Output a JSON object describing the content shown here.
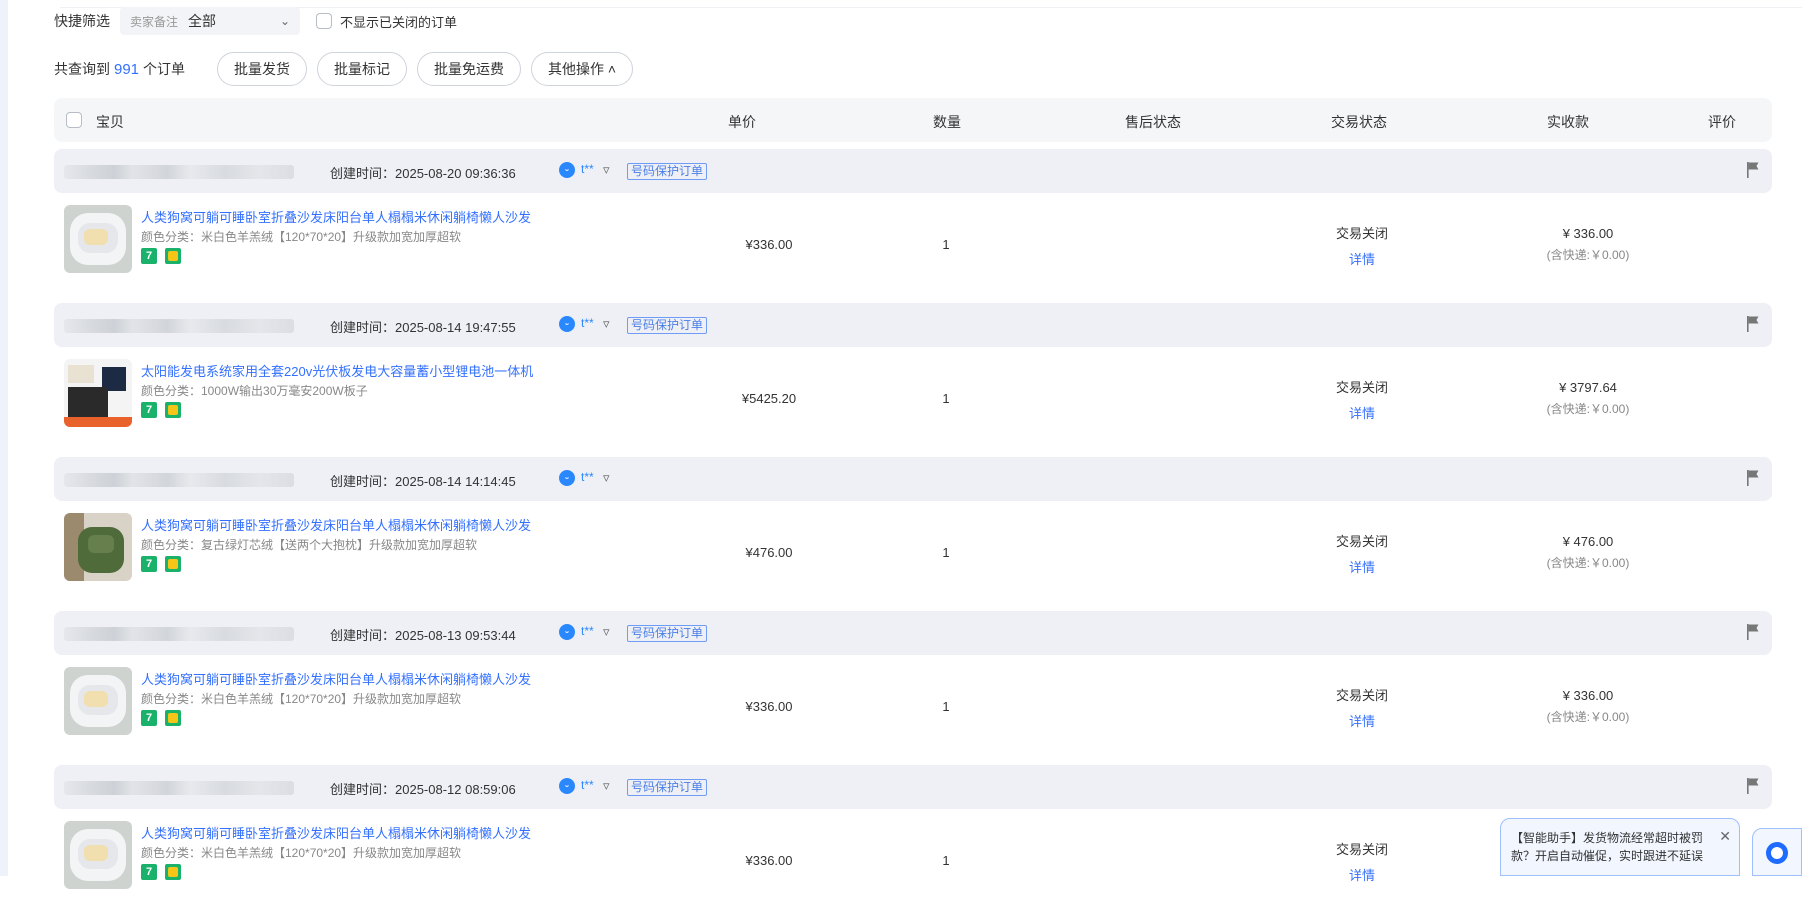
{
  "filter": {
    "label": "快捷筛选",
    "select_prefix": "卖家备注",
    "select_value": "全部",
    "hide_closed_label": "不显示已关闭的订单"
  },
  "summary": {
    "prefix": "共查询到",
    "count": "991",
    "suffix": "个订单"
  },
  "actions": {
    "batch_ship": "批量发货",
    "batch_mark": "批量标记",
    "batch_free_shipping": "批量免运费",
    "other_ops": "其他操作 ˄"
  },
  "columns": {
    "item": "宝贝",
    "unit_price": "单价",
    "quantity": "数量",
    "after_sale": "售后状态",
    "trade_status": "交易状态",
    "amount": "实收款",
    "review": "评价"
  },
  "orders": [
    {
      "created": "创建时间：2025-08-20 09:36:36",
      "buyer": "t**",
      "privacy_tag": "号码保护订单",
      "title": "人类狗窝可躺可睡卧室折叠沙发床阳台单人榻榻米休闲躺椅懒人沙发",
      "spec": "颜色分类：米白色羊羔绒【120*70*20】升级款加宽加厚超软",
      "price": "¥336.00",
      "qty": "1",
      "status": "交易关闭",
      "detail": "详情",
      "paid": "¥ 336.00",
      "shipping": "(含快递:￥0.00)"
    },
    {
      "created": "创建时间：2025-08-14 19:47:55",
      "buyer": "t**",
      "privacy_tag": "号码保护订单",
      "title": "太阳能发电系统家用全套220v光伏板发电大容量蓄小型锂电池一体机",
      "spec": "颜色分类：1000W输出30万毫安200W板子",
      "price": "¥5425.20",
      "qty": "1",
      "status": "交易关闭",
      "detail": "详情",
      "paid": "¥ 3797.64",
      "shipping": "(含快递:￥0.00)"
    },
    {
      "created": "创建时间：2025-08-14 14:14:45",
      "buyer": "t**",
      "privacy_tag": "",
      "title": "人类狗窝可躺可睡卧室折叠沙发床阳台单人榻榻米休闲躺椅懒人沙发",
      "spec": "颜色分类：复古绿灯芯绒【送两个大抱枕】升级款加宽加厚超软",
      "price": "¥476.00",
      "qty": "1",
      "status": "交易关闭",
      "detail": "详情",
      "paid": "¥ 476.00",
      "shipping": "(含快递:￥0.00)"
    },
    {
      "created": "创建时间：2025-08-13 09:53:44",
      "buyer": "t**",
      "privacy_tag": "号码保护订单",
      "title": "人类狗窝可躺可睡卧室折叠沙发床阳台单人榻榻米休闲躺椅懒人沙发",
      "spec": "颜色分类：米白色羊羔绒【120*70*20】升级款加宽加厚超软",
      "price": "¥336.00",
      "qty": "1",
      "status": "交易关闭",
      "detail": "详情",
      "paid": "¥ 336.00",
      "shipping": "(含快递:￥0.00)"
    },
    {
      "created": "创建时间：2025-08-12 08:59:06",
      "buyer": "t**",
      "privacy_tag": "号码保护订单",
      "title": "人类狗窝可躺可睡卧室折叠沙发床阳台单人榻榻米休闲躺椅懒人沙发",
      "spec": "颜色分类：米白色羊羔绒【120*70*20】升级款加宽加厚超软",
      "price": "¥336.00",
      "qty": "1",
      "status": "交易关闭",
      "detail": "详情",
      "paid": "",
      "shipping": ""
    }
  ],
  "toast": {
    "text": "【智能助手】发货物流经常超时被罚款？开启自动催促，实时跟进不延误"
  },
  "icons": {
    "wangwang": "wangwang-chat-icon",
    "funnel": "funnel-icon",
    "flag": "flag-icon",
    "close": "close-icon",
    "assistant": "assistant-icon"
  },
  "colors": {
    "accent": "#3370ff",
    "header_bg": "#eef0f5",
    "badge_green": "#1ab26b"
  }
}
